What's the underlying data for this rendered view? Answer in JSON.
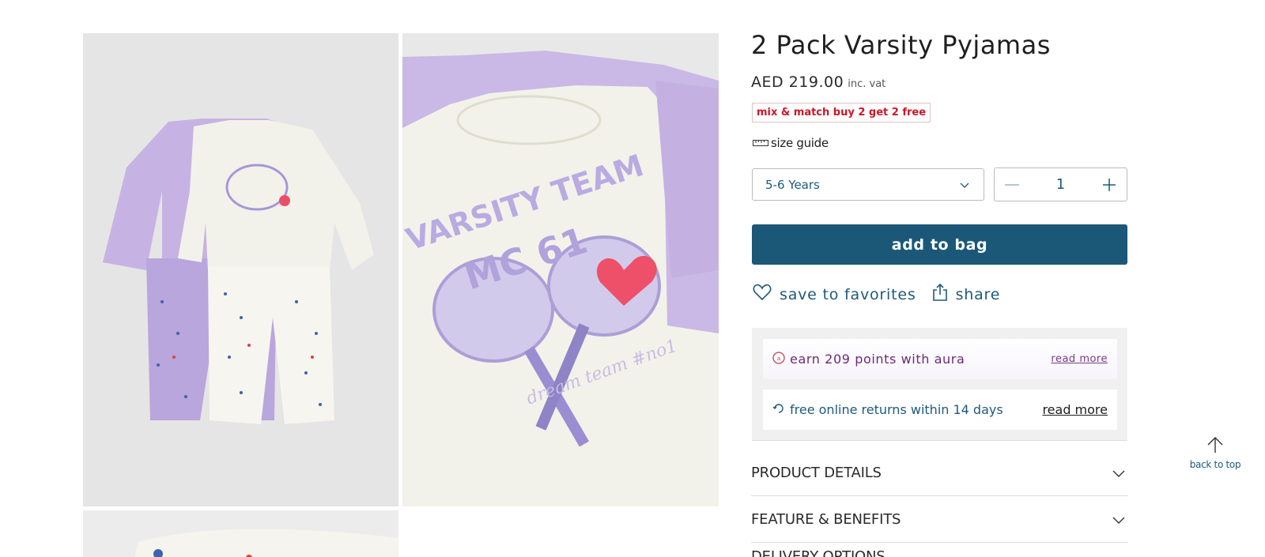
{
  "product": {
    "title": "2 Pack Varsity Pyjamas",
    "price": "AED 219.00",
    "vat_label": "inc. vat",
    "promo": "mix & match buy 2 get 2 free"
  },
  "size_guide": {
    "label": "size guide",
    "icon": "ruler-icon"
  },
  "size_select": {
    "selected": "5-6 Years",
    "icon": "chevron-down-icon"
  },
  "quantity": {
    "value": "1"
  },
  "add_to_bag": {
    "label": "add to bag"
  },
  "actions": {
    "favorites_label": "save to favorites",
    "share_label": "share"
  },
  "info": {
    "aura_text": "earn 209 points with aura",
    "aura_link": "read more",
    "returns_text": "free online returns within 14 days",
    "returns_link": "read more"
  },
  "accordion": [
    {
      "title": "PRODUCT DETAILS"
    },
    {
      "title": "FEATURE & BENEFITS"
    },
    {
      "title": "DELIVERY OPTIONS"
    }
  ],
  "back_to_top": {
    "label": "back to top"
  },
  "gallery": {
    "print_line1": "VARSITY TEAM",
    "print_line2": "MC 61",
    "print_script": "dream team #no1"
  },
  "colors": {
    "brand_blue": "#1b5878",
    "promo_red": "#cf1528",
    "aura_purple": "#6b2a78",
    "lilac": "#c8b6e6",
    "cream": "#f4f3ea"
  }
}
